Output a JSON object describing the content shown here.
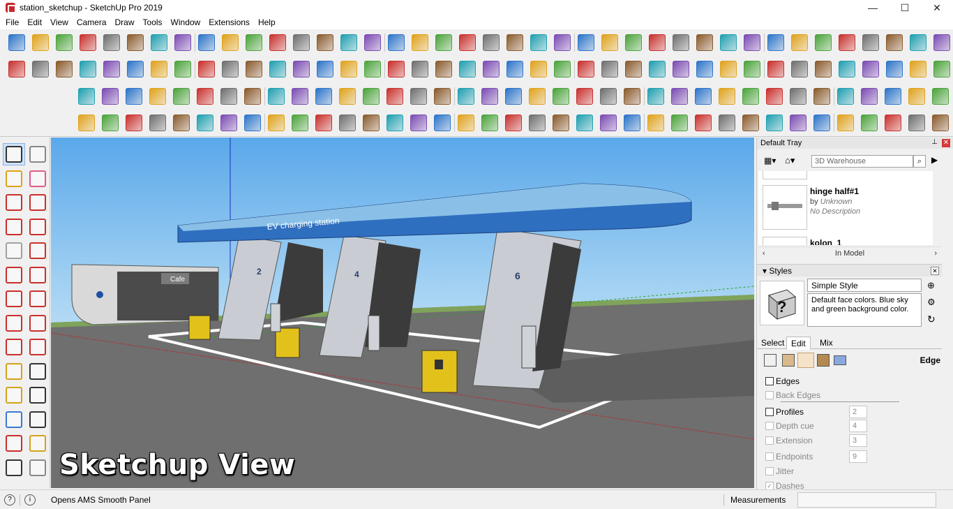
{
  "window": {
    "title": "station_sketchup - SketchUp Pro 2019",
    "controls": [
      "—",
      "☐",
      "✕"
    ]
  },
  "menu": [
    "File",
    "Edit",
    "View",
    "Camera",
    "Draw",
    "Tools",
    "Window",
    "Extensions",
    "Help"
  ],
  "viewport": {
    "overlay_caption": "Sketchup View",
    "model_sign": "EV charging station",
    "cafe_sign": "Cafe",
    "bay_numbers": [
      "2",
      "4",
      "6"
    ]
  },
  "tray": {
    "title": "Default Tray",
    "search_placeholder": "3D Warehouse",
    "components": [
      {
        "name": "hinge half#1",
        "by_label": "by",
        "author": "Unknown",
        "description": "No Description"
      },
      {
        "name": "kolon_1"
      }
    ],
    "nav_label": "In Model",
    "styles_title": "Styles",
    "style_name": "Simple Style",
    "style_description": "Default face colors. Blue sky and green background color.",
    "tabs": [
      "Select",
      "Edit",
      "Mix"
    ],
    "edit_panel_label": "Edge",
    "settings": [
      {
        "label": "Edges",
        "value": ""
      },
      {
        "label": "Back Edges",
        "value": ""
      },
      {
        "label": "Profiles",
        "value": "2"
      },
      {
        "label": "Depth cue",
        "value": "4"
      },
      {
        "label": "Extension",
        "value": "3"
      },
      {
        "label": "Endpoints",
        "value": "9"
      },
      {
        "label": "Jitter",
        "value": ""
      },
      {
        "label": "Dashes",
        "value": ""
      }
    ]
  },
  "status": {
    "message": "Opens AMS Smooth Panel",
    "measurements_label": "Measurements",
    "measurements_value": ""
  },
  "colors": {
    "sky_top": "#5aa8ea",
    "ground": "#6f6f6f",
    "canopy_blue": "#2f6fc0",
    "pump_yellow": "#e2c21a",
    "selection_blue": "#cfe3fb"
  }
}
